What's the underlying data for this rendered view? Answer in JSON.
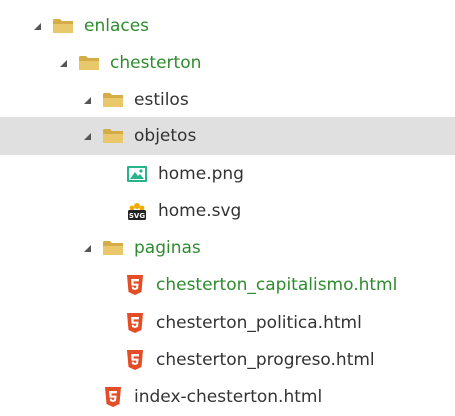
{
  "tree": {
    "items": [
      {
        "label": "enlaces",
        "type": "folder",
        "expanded": true,
        "color": "#2e8b2e"
      },
      {
        "label": "chesterton",
        "type": "folder",
        "expanded": true,
        "color": "#2e8b2e"
      },
      {
        "label": "estilos",
        "type": "folder",
        "expanded": true,
        "color": "#333333"
      },
      {
        "label": "objetos",
        "type": "folder",
        "expanded": true,
        "color": "#333333",
        "selected": true
      },
      {
        "label": "home.png",
        "type": "png-file",
        "color": "#333333"
      },
      {
        "label": "home.svg",
        "type": "svg-file",
        "color": "#333333"
      },
      {
        "label": "paginas",
        "type": "folder",
        "expanded": true,
        "color": "#2e8b2e"
      },
      {
        "label": "chesterton_capitalismo.html",
        "type": "html-file",
        "color": "#2e8b2e"
      },
      {
        "label": "chesterton_politica.html",
        "type": "html-file",
        "color": "#333333"
      },
      {
        "label": "chesterton_progreso.html",
        "type": "html-file",
        "color": "#333333"
      },
      {
        "label": "index-chesterton.html",
        "type": "html-file",
        "color": "#333333"
      }
    ]
  },
  "icons": {
    "folder": "folder-icon",
    "png-file": "image-file-icon",
    "svg-file": "svg-file-icon",
    "html-file": "html5-file-icon",
    "expand": "triangle-down-icon"
  },
  "colors": {
    "folder": "#e8c86a",
    "folder_dark": "#d4ad46",
    "html": "#e44d26",
    "png": "#26b58a",
    "selected_bg": "#e0e0e0"
  }
}
